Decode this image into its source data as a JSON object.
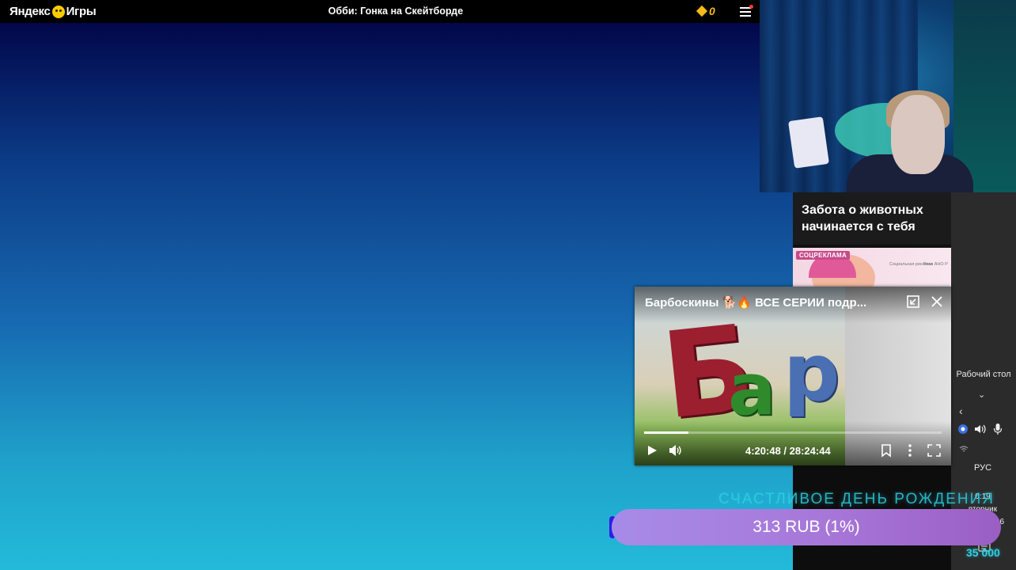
{
  "topbar": {
    "logo_part1": "Яндекс",
    "logo_part2": "Игры",
    "title": "Обби: Гонка на Скейтборде",
    "coins": "0"
  },
  "ad": {
    "title": "Забота о животных начинается с тебя",
    "badge": "СОЦРЕКЛАМА",
    "small_text_1": "Социальная реклама",
    "small_text_2": "Рекл АНО Р"
  },
  "pip_player": {
    "title": "Барбоскины 🐕🔥 ВСЕ СЕРИИ подр...",
    "letters": [
      "Б",
      "а",
      "р"
    ],
    "time": "4:20:48 / 28:24:44",
    "progress": 0.15
  },
  "overlay": {
    "marquee": "СЧАСТЛИВОЕ ДЕНЬ РОЖДЕНИЯ",
    "donation": "313 RUB (1%)",
    "goal": "35 000"
  },
  "taskbar": {
    "desktop_label": "Рабочий стол",
    "language": "РУС",
    "time": "0:19",
    "day": "вторник",
    "date": "04.08.2026"
  },
  "colors": {
    "coin": "#f5b91a",
    "donation": "#a78be8",
    "accent_cyan": "#2fd0e0"
  }
}
